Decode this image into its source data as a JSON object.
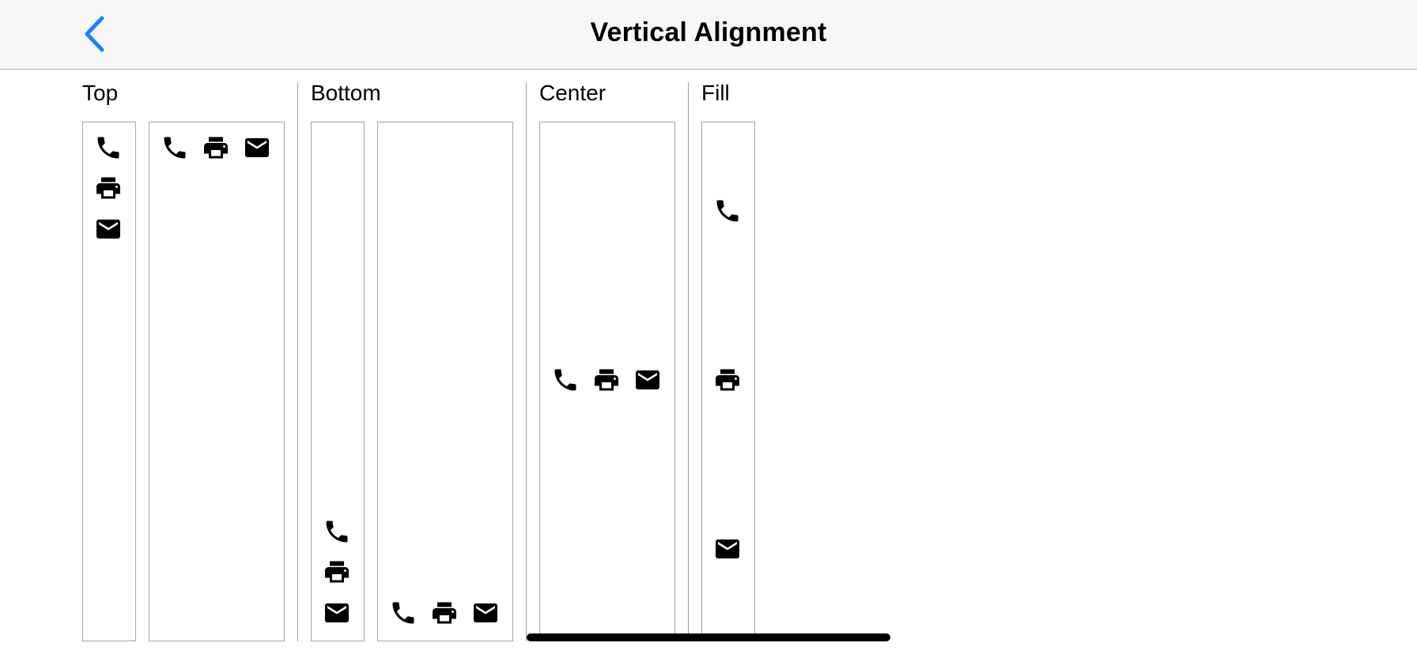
{
  "nav": {
    "title": "Vertical Alignment",
    "back_icon": "chevron-left-icon",
    "accent_color": "#1a82fb"
  },
  "sections": {
    "top": {
      "label": "Top"
    },
    "bottom": {
      "label": "Bottom"
    },
    "center": {
      "label": "Center"
    },
    "fill": {
      "label": "Fill"
    }
  },
  "icons": [
    "phone-icon",
    "print-icon",
    "mail-icon"
  ]
}
